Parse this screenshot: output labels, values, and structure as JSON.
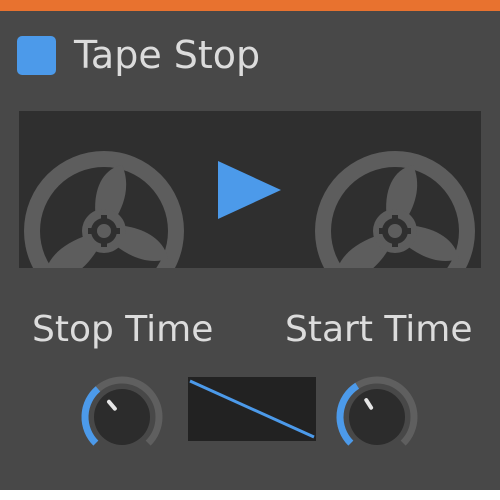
{
  "plugin": {
    "title": "Tape Stop",
    "enabled": true
  },
  "reel_display": {
    "play_state": "play-icon"
  },
  "controls": {
    "stop_time": {
      "label": "Stop Time",
      "level": 0.35
    },
    "start_time": {
      "label": "Start Time",
      "level": 0.38
    }
  },
  "curve": {
    "shape": "linear-descending"
  },
  "colors": {
    "accent": "#4c9aea",
    "header_strip": "#e8722f",
    "panel": "#484848",
    "display_bg": "#2f2f2f",
    "reel": "#5d5d5d",
    "text": "#dcdcdc"
  }
}
